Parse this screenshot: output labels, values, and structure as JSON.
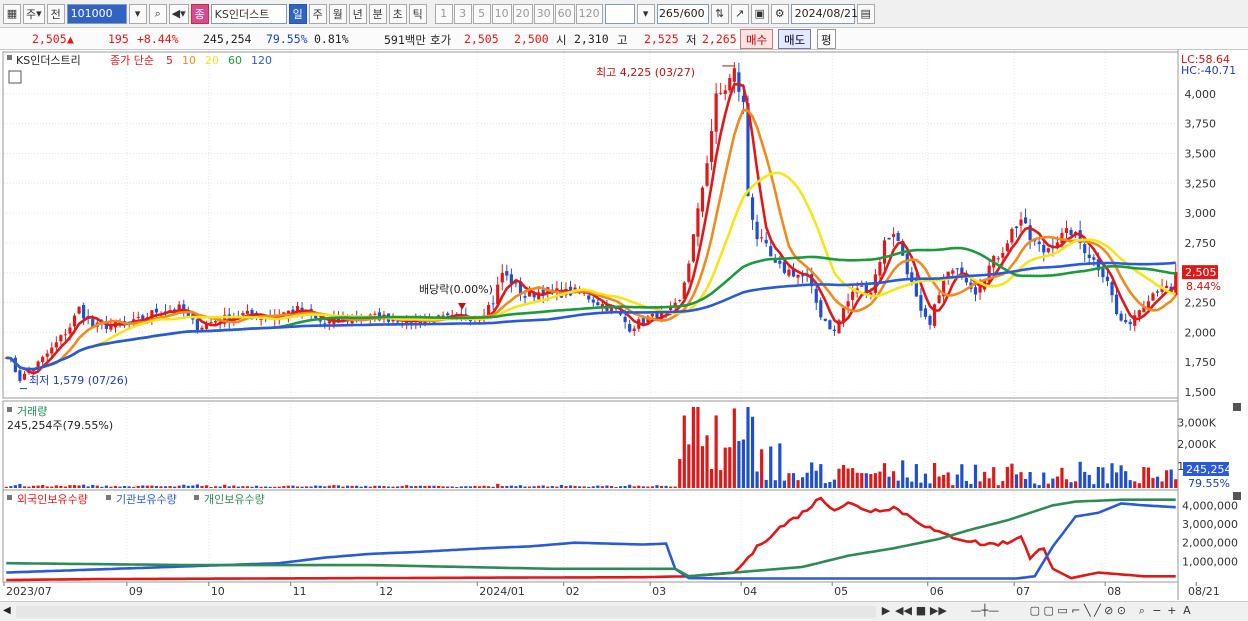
{
  "toolbar": {
    "mode_day_button": "주",
    "prev_label": "전",
    "stock_code": "101000",
    "badge_label": "종",
    "stock_name": "KS인더스트",
    "period_buttons": [
      "일",
      "주",
      "월",
      "년",
      "분",
      "초",
      "틱"
    ],
    "active_period": "일",
    "interval_buttons": [
      "1",
      "3",
      "5",
      "10",
      "20",
      "30",
      "60",
      "120"
    ],
    "count_display": "265/600",
    "date": "2024/08/21"
  },
  "quote": {
    "price": "2,505",
    "change_arrow": "▲",
    "change": "195",
    "change_pct": "+8.44%",
    "volume": "245,254",
    "volume_ratio": "79.55%",
    "turnover": "0.81%",
    "amount": "591백만",
    "bid_ask_label": "호가",
    "ask": "2,505",
    "bid": "2,500",
    "open_label": "시",
    "open": "2,310",
    "high_label": "고",
    "high": "2,525",
    "low_label": "저",
    "low": "2,265",
    "buy_button": "매수",
    "sell_button": "매도",
    "eval_button": "평"
  },
  "chart_data": [
    {
      "type": "candlestick",
      "title": "KS인더스트리",
      "legend_prefix": "종가 단순",
      "ma_periods": [
        "5",
        "10",
        "20",
        "60",
        "120"
      ],
      "ma_colors": [
        "#e01818",
        "#f08a1c",
        "#f5e61a",
        "#1e9a3c",
        "#2a5ad8"
      ],
      "up_color": "#e01818",
      "down_color": "#1f4fd0",
      "ylim": [
        1450,
        4300
      ],
      "y_ticks": [
        "4,000",
        "3,750",
        "3,500",
        "3,250",
        "3,000",
        "2,750",
        "2,500",
        "2,250",
        "2,000",
        "1,750",
        "1,500"
      ],
      "y_tick_values": [
        4000,
        3750,
        3500,
        3250,
        3000,
        2750,
        2500,
        2250,
        2000,
        1750,
        1500
      ],
      "x_labels": [
        "2023/07",
        "09",
        "10",
        "11",
        "12",
        "2024/01",
        "02",
        "03",
        "04",
        "05",
        "06",
        "07",
        "08",
        "08/21"
      ],
      "x_label_index": [
        0,
        27,
        45,
        63,
        82,
        104,
        123,
        142,
        162,
        182,
        203,
        222,
        242,
        262
      ],
      "annotations": {
        "high": "최고 4,225 (03/27)",
        "high_value": 4225,
        "low": "최저 1,579 (07/26)",
        "low_value": 1579,
        "dividend": "배당락(0.00%)",
        "lc": "LC:58.64",
        "hc": "HC:-40.71",
        "last_price": "2,505",
        "last_pct": "8.44%"
      },
      "close_keypoints": [
        [
          0,
          1820
        ],
        [
          3,
          1610
        ],
        [
          6,
          1700
        ],
        [
          10,
          1860
        ],
        [
          14,
          2050
        ],
        [
          16,
          2200
        ],
        [
          19,
          2050
        ],
        [
          24,
          2060
        ],
        [
          28,
          2080
        ],
        [
          33,
          2180
        ],
        [
          38,
          2200
        ],
        [
          42,
          2040
        ],
        [
          46,
          2100
        ],
        [
          52,
          2150
        ],
        [
          58,
          2140
        ],
        [
          64,
          2190
        ],
        [
          70,
          2070
        ],
        [
          76,
          2120
        ],
        [
          82,
          2130
        ],
        [
          88,
          2100
        ],
        [
          94,
          2110
        ],
        [
          100,
          2120
        ],
        [
          104,
          2140
        ],
        [
          107,
          2260
        ],
        [
          109,
          2500
        ],
        [
          111,
          2420
        ],
        [
          114,
          2300
        ],
        [
          118,
          2350
        ],
        [
          122,
          2330
        ],
        [
          126,
          2340
        ],
        [
          130,
          2250
        ],
        [
          134,
          2180
        ],
        [
          137,
          2040
        ],
        [
          141,
          2120
        ],
        [
          145,
          2140
        ],
        [
          148,
          2250
        ],
        [
          150,
          2600
        ],
        [
          152,
          3000
        ],
        [
          154,
          3450
        ],
        [
          156,
          3950
        ],
        [
          158,
          4050
        ],
        [
          160,
          4180
        ],
        [
          162,
          3900
        ],
        [
          163,
          3150
        ],
        [
          165,
          2800
        ],
        [
          167,
          2700
        ],
        [
          169,
          2550
        ],
        [
          173,
          2500
        ],
        [
          176,
          2450
        ],
        [
          179,
          2150
        ],
        [
          182,
          2000
        ],
        [
          184,
          2200
        ],
        [
          187,
          2380
        ],
        [
          190,
          2350
        ],
        [
          193,
          2750
        ],
        [
          195,
          2850
        ],
        [
          197,
          2650
        ],
        [
          199,
          2400
        ],
        [
          201,
          2150
        ],
        [
          203,
          2050
        ],
        [
          205,
          2350
        ],
        [
          207,
          2500
        ],
        [
          210,
          2500
        ],
        [
          213,
          2350
        ],
        [
          216,
          2550
        ],
        [
          219,
          2700
        ],
        [
          221,
          2850
        ],
        [
          223,
          2950
        ],
        [
          225,
          2780
        ],
        [
          228,
          2680
        ],
        [
          231,
          2780
        ],
        [
          234,
          2850
        ],
        [
          237,
          2700
        ],
        [
          240,
          2550
        ],
        [
          242,
          2450
        ],
        [
          244,
          2150
        ],
        [
          246,
          2050
        ],
        [
          248,
          2150
        ],
        [
          251,
          2300
        ],
        [
          254,
          2400
        ],
        [
          256,
          2310
        ],
        [
          257,
          2505
        ]
      ],
      "volume": {
        "label": "거래량",
        "value_label": "245,254주(79.55%)",
        "y_ticks": [
          "3,000K",
          "2,000K",
          "1,000K"
        ],
        "y_tick_values": [
          3000,
          2000,
          1000
        ],
        "last": "245,254",
        "last_pct": "79.55%"
      },
      "holdings": {
        "series_names": [
          "외국인보유수량",
          "기관보유수량",
          "개인보유수량"
        ],
        "series_colors": [
          "#e01818",
          "#2a5ad8",
          "#2e8b57"
        ],
        "y_ticks": [
          "4,000,000",
          "3,000,000",
          "2,000,000",
          "1,000,000"
        ],
        "y_tick_values": [
          4000000,
          3000000,
          2000000,
          1000000
        ],
        "ylim": [
          0,
          4500000
        ],
        "foreign_keypoints": [
          [
            0,
            0
          ],
          [
            20,
            50000
          ],
          [
            100,
            120000
          ],
          [
            140,
            150000
          ],
          [
            150,
            200000
          ],
          [
            160,
            400000
          ],
          [
            162,
            900000
          ],
          [
            166,
            2000000
          ],
          [
            170,
            2800000
          ],
          [
            175,
            3600000
          ],
          [
            179,
            4400000
          ],
          [
            182,
            3800000
          ],
          [
            185,
            4100000
          ],
          [
            190,
            3700000
          ],
          [
            195,
            3900000
          ],
          [
            200,
            3200000
          ],
          [
            205,
            2500000
          ],
          [
            210,
            2200000
          ],
          [
            215,
            1900000
          ],
          [
            220,
            2000000
          ],
          [
            223,
            2400000
          ],
          [
            225,
            1100000
          ],
          [
            228,
            1800000
          ],
          [
            230,
            600000
          ],
          [
            234,
            100000
          ],
          [
            240,
            400000
          ],
          [
            245,
            300000
          ],
          [
            250,
            200000
          ],
          [
            257,
            200000
          ]
        ],
        "institution_keypoints": [
          [
            0,
            400000
          ],
          [
            60,
            900000
          ],
          [
            70,
            1200000
          ],
          [
            80,
            1400000
          ],
          [
            90,
            1500000
          ],
          [
            105,
            1700000
          ],
          [
            115,
            1800000
          ],
          [
            125,
            2000000
          ],
          [
            140,
            1900000
          ],
          [
            145,
            1950000
          ],
          [
            147,
            600000
          ],
          [
            150,
            100000
          ],
          [
            160,
            80000
          ],
          [
            182,
            80000
          ],
          [
            222,
            80000
          ],
          [
            226,
            200000
          ],
          [
            230,
            1800000
          ],
          [
            235,
            3400000
          ],
          [
            240,
            3600000
          ],
          [
            245,
            4100000
          ],
          [
            250,
            4000000
          ],
          [
            257,
            3900000
          ]
        ],
        "individual_keypoints": [
          [
            0,
            900000
          ],
          [
            40,
            800000
          ],
          [
            80,
            800000
          ],
          [
            120,
            600000
          ],
          [
            147,
            600000
          ],
          [
            150,
            200000
          ],
          [
            160,
            400000
          ],
          [
            175,
            700000
          ],
          [
            185,
            1300000
          ],
          [
            195,
            1700000
          ],
          [
            205,
            2200000
          ],
          [
            212,
            2700000
          ],
          [
            220,
            3200000
          ],
          [
            225,
            3600000
          ],
          [
            230,
            4000000
          ],
          [
            235,
            4200000
          ],
          [
            245,
            4300000
          ],
          [
            257,
            4300000
          ]
        ]
      }
    }
  ],
  "bottom": {
    "nav_icons": [
      "play-icon",
      "rewind-icon",
      "stop-icon",
      "fast-forward-icon",
      "zoom-out-icon",
      "minus-icon",
      "plus-icon"
    ]
  }
}
